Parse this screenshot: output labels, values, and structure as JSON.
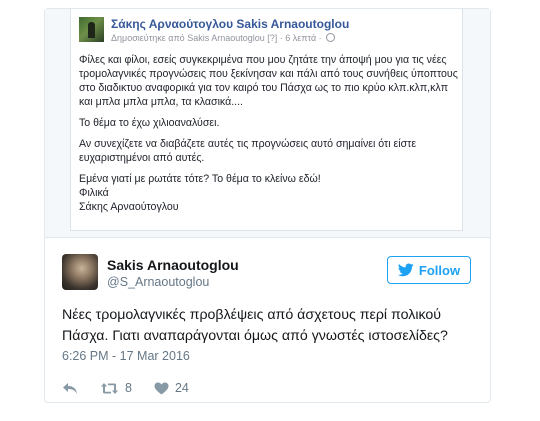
{
  "facebook_post": {
    "author": "Σάκης Αρναούτογλου Sakis Arnaoutoglou",
    "meta_published_by": "Δημοσιεύτηκε από Sakis Arnaoutoglou",
    "meta_sep": "[?] ·",
    "meta_time": "6 λεπτά ·",
    "paragraphs": [
      "Φίλες και φίλοι, εσείς συγκεκριμένα που μου ζητάτε την άποψή μου για τις νέες τρομολαγνικές προγνώσεις που ξεκίνησαν και πάλι από τους συνήθεις ύποπτους στο διαδικτυο αναφορικά για τον καιρό του Πάσχα ως το πιο κρύο κλπ.κλπ,κλπ και μπλα μπλα μπλα, τα κλασικά....",
      "Το θέμα το έχω χιλιοαναλύσει.",
      "Αν συνεχίζετε να διαβάζετε αυτές τις προγνώσεις αυτό σημαίνει ότι είστε ευχαριστημένοι από αυτές."
    ],
    "closing": [
      "Εμένα γιατί με ρωτάτε τότε? Το θέμα το κλείνω εδώ!",
      "Φιλικά",
      "Σάκης Αρναούτογλου"
    ]
  },
  "tweet": {
    "display_name": "Sakis Arnaoutoglou",
    "handle": "@S_Arnaoutoglou",
    "follow_label": "Follow",
    "text": "Νέες τρομολαγνικές προβλέψεις από άσχετους περί πολικού Πάσχα. Γιατι αναπαράγονται όμως από γνωστές ιστοσελίδες?",
    "timestamp": "6:26 PM - 17 Mar 2016",
    "retweet_count": "8",
    "like_count": "24"
  },
  "colors": {
    "twitter_blue": "#1da1f2",
    "facebook_link": "#365899",
    "muted": "#657786"
  },
  "icons": [
    "bird-icon",
    "reply-icon",
    "retweet-icon",
    "heart-icon",
    "globe-icon"
  ]
}
